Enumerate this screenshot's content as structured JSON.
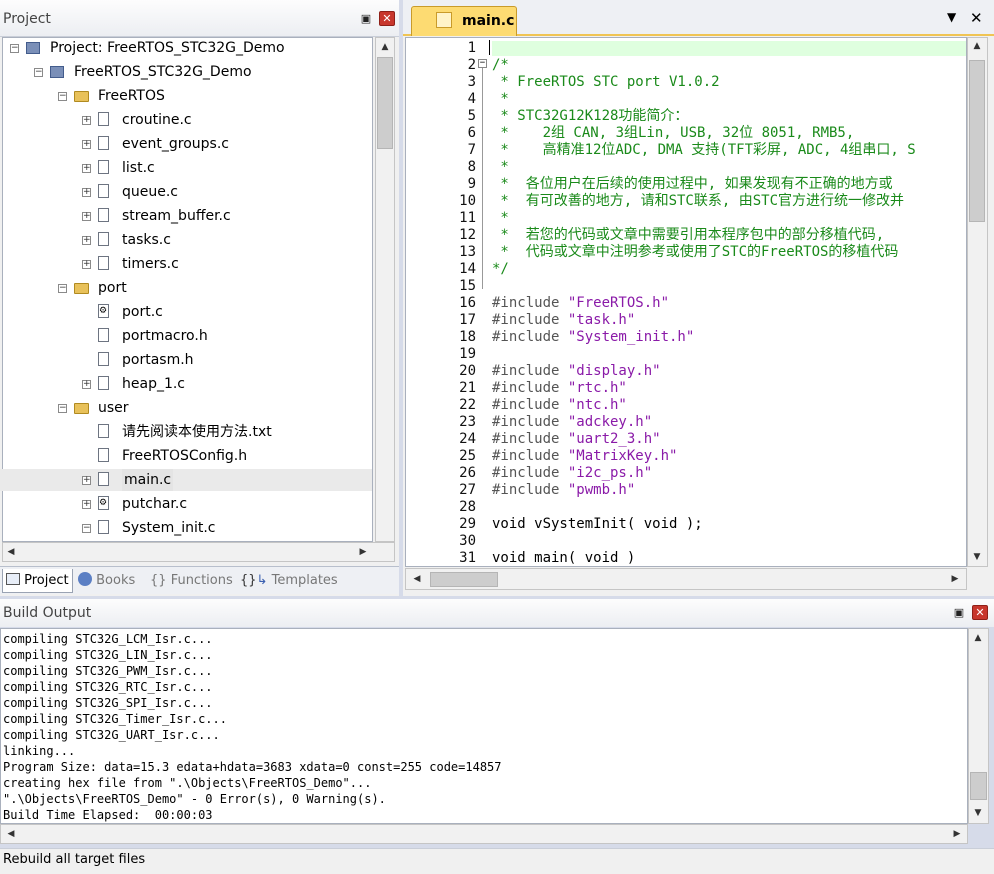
{
  "project_panel": {
    "title": "Project",
    "tree": [
      {
        "label": "Project: FreeRTOS_STC32G_Demo",
        "expander": "−",
        "icon": "project-icon"
      },
      {
        "label": "FreeRTOS_STC32G_Demo",
        "expander": "−",
        "icon": "target-icon"
      },
      {
        "label": "FreeRTOS",
        "expander": "−",
        "icon": "folder-icon"
      },
      {
        "label": "croutine.c",
        "expander": "+",
        "icon": "file-icon"
      },
      {
        "label": "event_groups.c",
        "expander": "+",
        "icon": "file-icon"
      },
      {
        "label": "list.c",
        "expander": "+",
        "icon": "file-icon"
      },
      {
        "label": "queue.c",
        "expander": "+",
        "icon": "file-icon"
      },
      {
        "label": "stream_buffer.c",
        "expander": "+",
        "icon": "file-icon"
      },
      {
        "label": "tasks.c",
        "expander": "+",
        "icon": "file-icon"
      },
      {
        "label": "timers.c",
        "expander": "+",
        "icon": "file-icon"
      },
      {
        "label": "port",
        "expander": "−",
        "icon": "folder-icon"
      },
      {
        "label": "port.c",
        "expander": "",
        "icon": "file-asm-icon"
      },
      {
        "label": "portmacro.h",
        "expander": "",
        "icon": "file-icon"
      },
      {
        "label": "portasm.h",
        "expander": "",
        "icon": "file-icon"
      },
      {
        "label": "heap_1.c",
        "expander": "+",
        "icon": "file-icon"
      },
      {
        "label": "user",
        "expander": "−",
        "icon": "folder-icon"
      },
      {
        "label": "请先阅读本使用方法.txt",
        "expander": "",
        "icon": "file-icon"
      },
      {
        "label": "FreeRTOSConfig.h",
        "expander": "",
        "icon": "file-icon"
      },
      {
        "label": "main.c",
        "expander": "+",
        "icon": "file-icon"
      },
      {
        "label": "putchar.c",
        "expander": "+",
        "icon": "file-asm-icon"
      },
      {
        "label": "System_init.c",
        "expander": "−",
        "icon": "file-icon"
      }
    ],
    "tabs": [
      {
        "label": "Project",
        "icon": "project-tab-icon"
      },
      {
        "label": "Books",
        "icon": "books-icon"
      },
      {
        "label": "Functions",
        "icon": "braces-icon"
      },
      {
        "label": "Templates",
        "icon": "templates-icon"
      }
    ]
  },
  "editor": {
    "tab_label": "main.c",
    "line_numbers": [
      "1",
      "2",
      "3",
      "4",
      "5",
      "6",
      "7",
      "8",
      "9",
      "10",
      "11",
      "12",
      "13",
      "14",
      "15",
      "16",
      "17",
      "18",
      "19",
      "20",
      "21",
      "22",
      "23",
      "24",
      "25",
      "26",
      "27",
      "28",
      "29",
      "30",
      "31"
    ],
    "lines": [
      "",
      "/*",
      " * FreeRTOS STC port V1.0.2",
      " *",
      " * STC32G12K128功能简介：",
      " *    2组 CAN, 3组Lin, USB, 32位 8051, RMB5,",
      " *    高精准12位ADC, DMA 支持(TFT彩屏, ADC, 4组串口, S",
      " *",
      " *  各位用户在后续的使用过程中, 如果发现有不正确的地方或",
      " *  有可改善的地方, 请和STC联系, 由STC官方进行统一修改并",
      " *",
      " *  若您的代码或文章中需要引用本程序包中的部分移植代码,",
      " *  代码或文章中注明参考或使用了STC的FreeRTOS的移植代码",
      "*/",
      "",
      "#include \"FreeRTOS.h\"",
      "#include \"task.h\"",
      "#include \"System_init.h\"",
      "",
      "#include \"display.h\"",
      "#include \"rtc.h\"",
      "#include \"ntc.h\"",
      "#include \"adckey.h\"",
      "#include \"uart2_3.h\"",
      "#include \"MatrixKey.h\"",
      "#include \"i2c_ps.h\"",
      "#include \"pwmb.h\"",
      "",
      "void vSystemInit( void );",
      "",
      "void main( void )"
    ]
  },
  "build_output": {
    "title": "Build Output",
    "lines": [
      "compiling STC32G_LCM_Isr.c...",
      "compiling STC32G_LIN_Isr.c...",
      "compiling STC32G_PWM_Isr.c...",
      "compiling STC32G_RTC_Isr.c...",
      "compiling STC32G_SPI_Isr.c...",
      "compiling STC32G_Timer_Isr.c...",
      "compiling STC32G_UART_Isr.c...",
      "linking...",
      "Program Size: data=15.3 edata+hdata=3683 xdata=0 const=255 code=14857",
      "creating hex file from \".\\Objects\\FreeRTOS_Demo\"...",
      "\".\\Objects\\FreeRTOS_Demo\" - 0 Error(s), 0 Warning(s).",
      "Build Time Elapsed:  00:00:03"
    ]
  },
  "status_bar": {
    "text": "Rebuild all target files"
  },
  "icons": {
    "pin": "pin-icon",
    "close": "close-icon",
    "menu": "dropdown-icon"
  }
}
